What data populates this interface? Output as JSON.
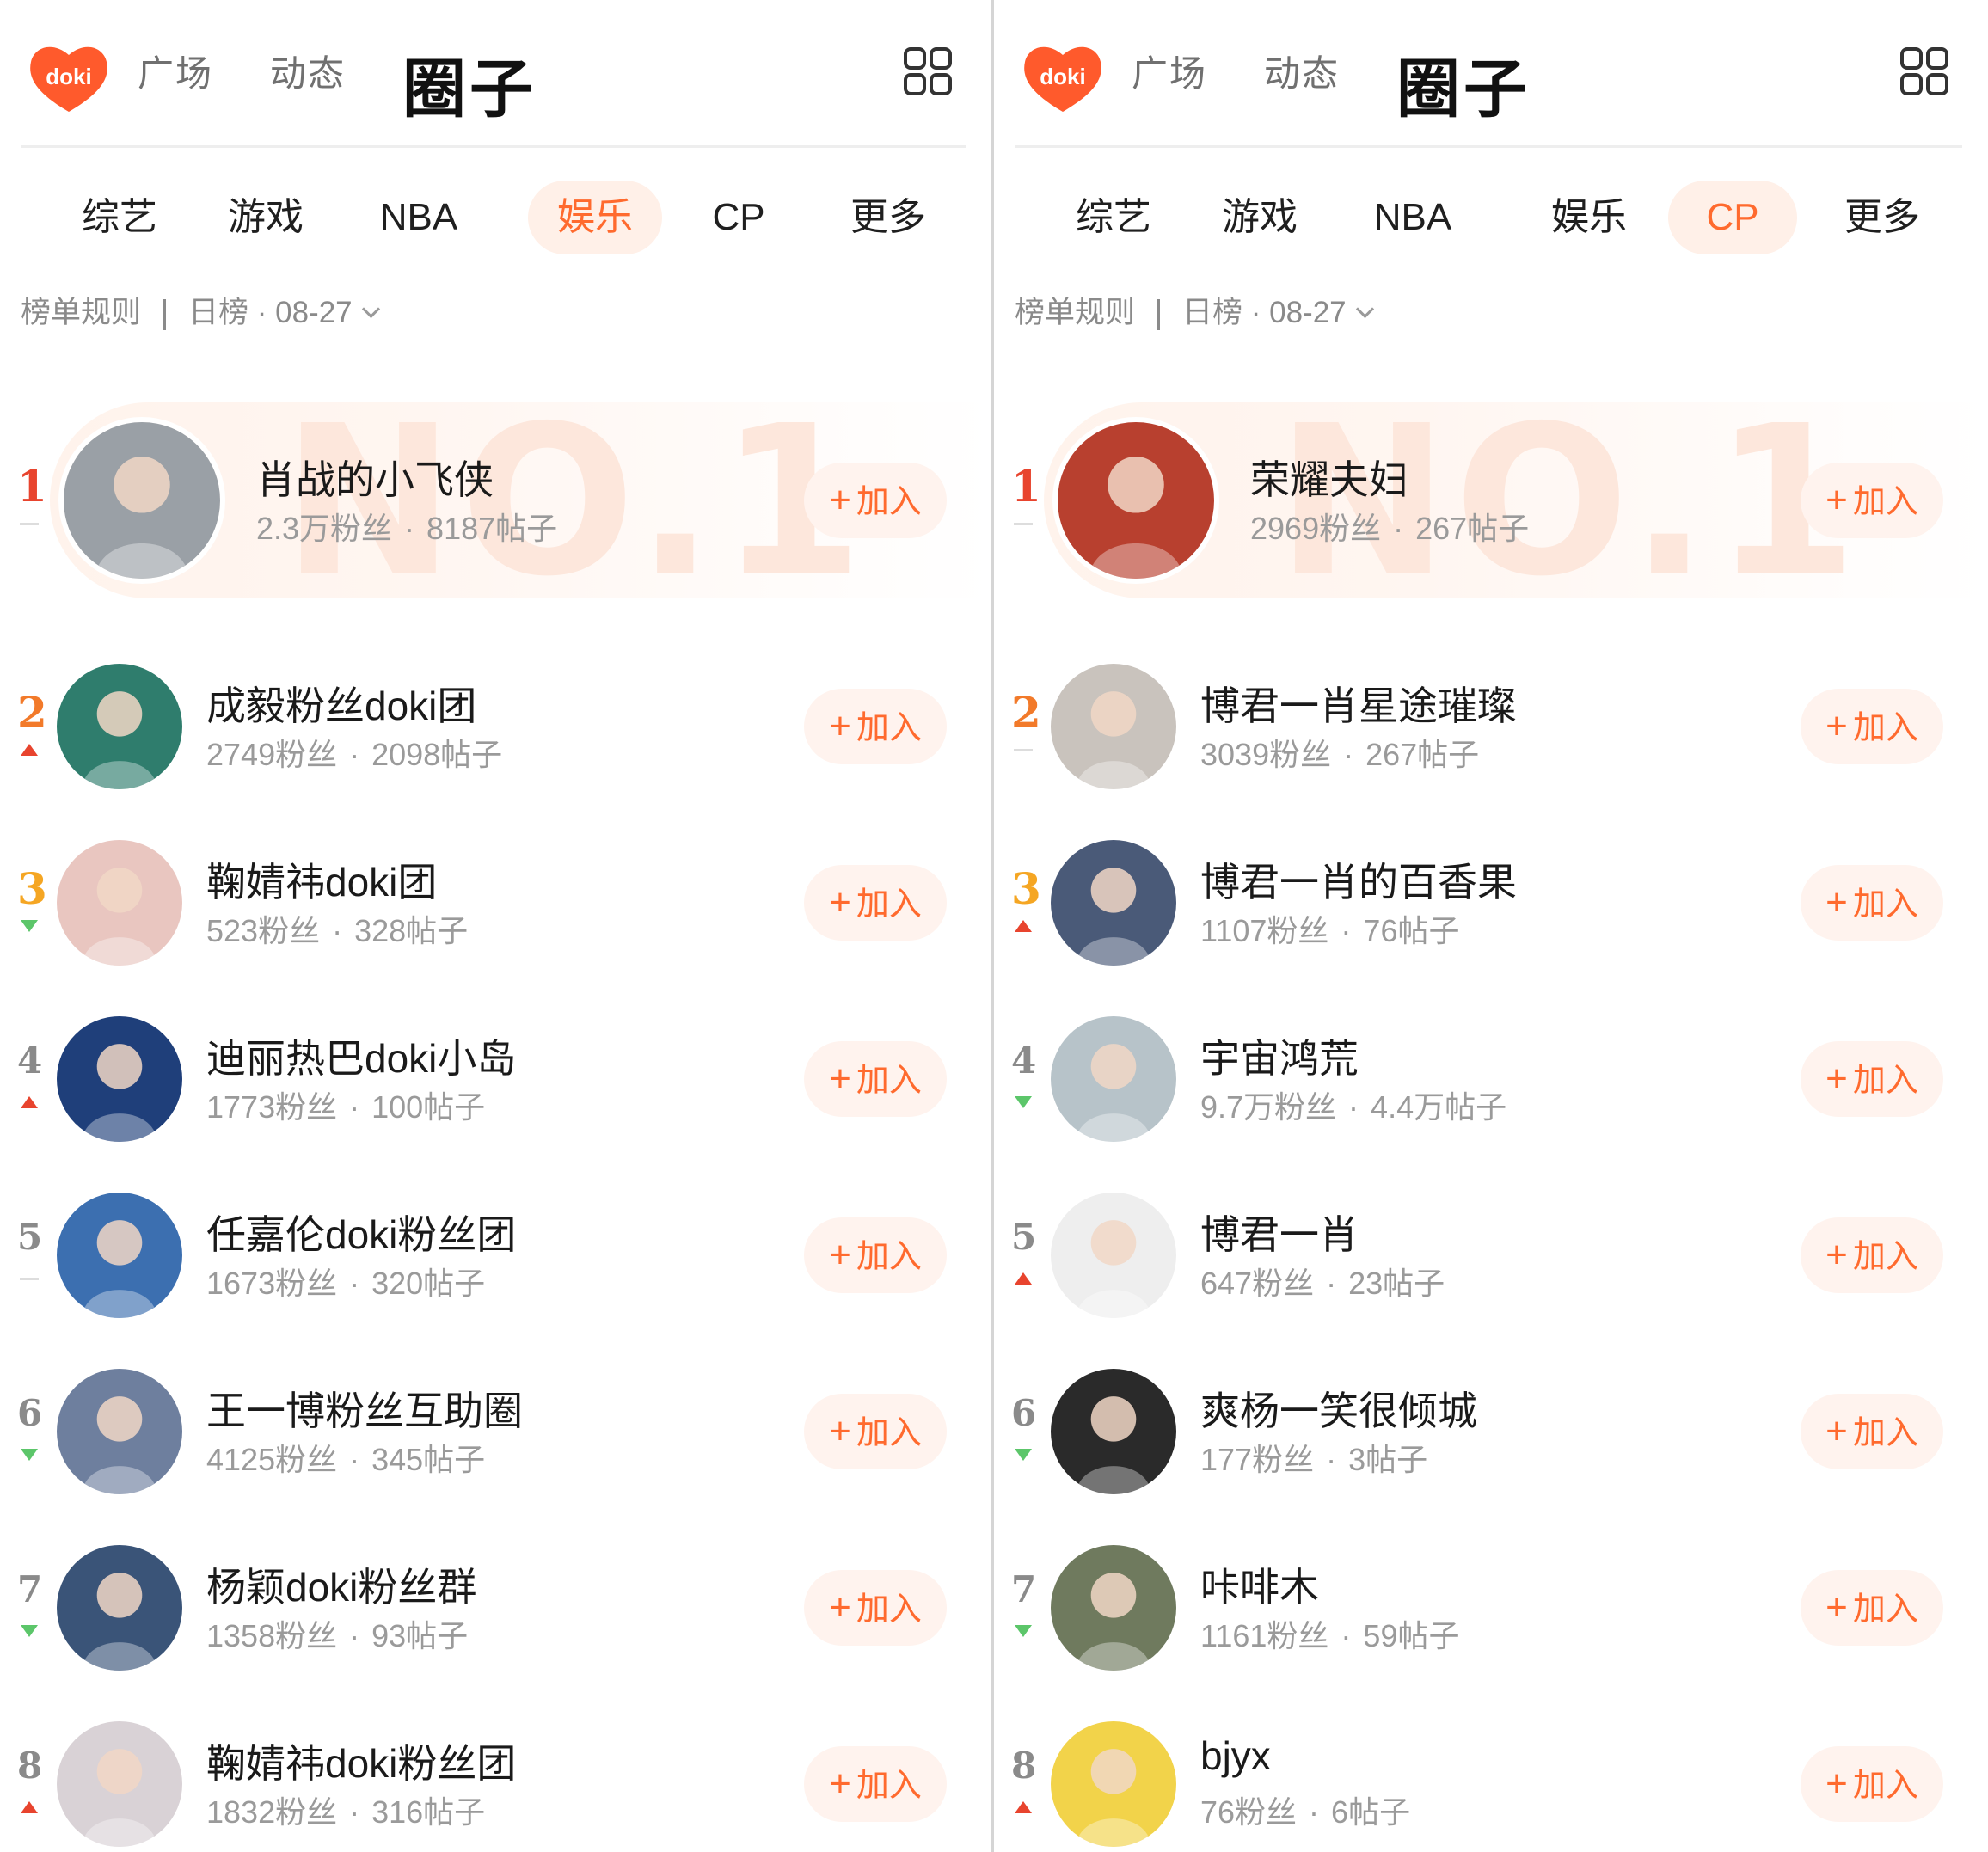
{
  "colors": {
    "accent": "#ff6a2e",
    "rank1": "#e8442e",
    "rank2": "#f27a2a",
    "rank3": "#f5a623",
    "up": "#e8442e",
    "down": "#5cc66a"
  },
  "panels": [
    {
      "logo_text": "doki",
      "nav": [
        "广场",
        "动态",
        "圈子"
      ],
      "tabs": [
        "综艺",
        "游戏",
        "NBA",
        "娱乐",
        "CP",
        "更多"
      ],
      "selected_tab": "娱乐",
      "rule_label": "榜单规则",
      "date_label": "日榜 · 08-27",
      "watermark": "NO.1",
      "join_label": "加入",
      "items": [
        {
          "rank": "1",
          "trend": "same",
          "name": "肖战的小飞侠",
          "fans": "2.3万粉丝",
          "posts": "8187帖子",
          "avatar_color": "#9aa0a6"
        },
        {
          "rank": "2",
          "trend": "up",
          "name": "成毅粉丝doki团",
          "fans": "2749粉丝",
          "posts": "2098帖子",
          "avatar_color": "#2f7d6d"
        },
        {
          "rank": "3",
          "trend": "down",
          "name": "鞠婧祎doki团",
          "fans": "523粉丝",
          "posts": "328帖子",
          "avatar_color": "#e9c6c0"
        },
        {
          "rank": "4",
          "trend": "up",
          "name": "迪丽热巴doki小岛",
          "fans": "1773粉丝",
          "posts": "100帖子",
          "avatar_color": "#1f3f7a"
        },
        {
          "rank": "5",
          "trend": "same",
          "name": "任嘉伦doki粉丝团",
          "fans": "1673粉丝",
          "posts": "320帖子",
          "avatar_color": "#3c6fb0"
        },
        {
          "rank": "6",
          "trend": "down",
          "name": "王一博粉丝互助圈",
          "fans": "4125粉丝",
          "posts": "345帖子",
          "avatar_color": "#6e7f9e"
        },
        {
          "rank": "7",
          "trend": "down",
          "name": "杨颖doki粉丝群",
          "fans": "1358粉丝",
          "posts": "93帖子",
          "avatar_color": "#3a5478"
        },
        {
          "rank": "8",
          "trend": "up",
          "name": "鞠婧祎doki粉丝团",
          "fans": "1832粉丝",
          "posts": "316帖子",
          "avatar_color": "#d9d2d6"
        }
      ]
    },
    {
      "logo_text": "doki",
      "nav": [
        "广场",
        "动态",
        "圈子"
      ],
      "tabs": [
        "综艺",
        "游戏",
        "NBA",
        "娱乐",
        "CP",
        "更多"
      ],
      "selected_tab": "CP",
      "rule_label": "榜单规则",
      "date_label": "日榜 · 08-27",
      "watermark": "NO.1",
      "join_label": "加入",
      "items": [
        {
          "rank": "1",
          "trend": "same",
          "name": "荣耀夫妇",
          "fans": "2969粉丝",
          "posts": "267帖子",
          "avatar_color": "#b8402f"
        },
        {
          "rank": "2",
          "trend": "same",
          "name": "博君一肖星途璀璨",
          "fans": "3039粉丝",
          "posts": "267帖子",
          "avatar_color": "#c9c3bd"
        },
        {
          "rank": "3",
          "trend": "up",
          "name": "博君一肖的百香果",
          "fans": "1107粉丝",
          "posts": "76帖子",
          "avatar_color": "#4a5a78"
        },
        {
          "rank": "4",
          "trend": "down",
          "name": "宇宙鸿荒",
          "fans": "9.7万粉丝",
          "posts": "4.4万帖子",
          "avatar_color": "#b7c3c9"
        },
        {
          "rank": "5",
          "trend": "up",
          "name": "博君一肖",
          "fans": "647粉丝",
          "posts": "23帖子",
          "avatar_color": "#eeeeee"
        },
        {
          "rank": "6",
          "trend": "down",
          "name": "爽杨一笑很倾城",
          "fans": "177粉丝",
          "posts": "3帖子",
          "avatar_color": "#2a2a2a"
        },
        {
          "rank": "7",
          "trend": "down",
          "name": "咔啡木",
          "fans": "1161粉丝",
          "posts": "59帖子",
          "avatar_color": "#6f7a5e"
        },
        {
          "rank": "8",
          "trend": "up",
          "name": "bjyx",
          "fans": "76粉丝",
          "posts": "6帖子",
          "avatar_color": "#f2d34a"
        }
      ]
    }
  ]
}
